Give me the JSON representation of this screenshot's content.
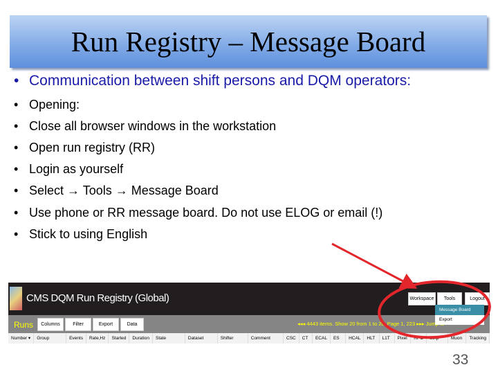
{
  "slide": {
    "title": "Run Registry – Message Board",
    "page_number": "33",
    "bullets": [
      "Communication between shift persons and DQM operators:",
      "Opening:",
      "Close all browser windows in the workstation",
      "Open run registry (RR)",
      "Login as yourself",
      "Select → Tools → Message Board",
      "Use phone or RR message board. Do not use ELOG or email (!)",
      "Stick to using English"
    ],
    "bullet_char": "•",
    "accent": "#e3262b"
  },
  "screenshot": {
    "app_title": "CMS DQM Run Registry (Global)",
    "section": "Runs",
    "toolbar_buttons": [
      "Columns",
      "Filter",
      "Export",
      "Data"
    ],
    "top_buttons": [
      "Workspace",
      "Tools",
      "Logout"
    ],
    "menu_items": [
      "Message Board",
      "Export"
    ],
    "pagination": "4443 items. Show 20 from 1 to 20. Page 1, 223",
    "jump_to": "Jump to",
    "columns": [
      "Number ▾",
      "Group",
      "Events",
      "Rate,Hz",
      "Started",
      "Duration",
      "State",
      "Dataset",
      "Shifter",
      "Comment",
      "CSC",
      "CT",
      "ECAL",
      "ES",
      "HCAL",
      "HLT",
      "L1T",
      "Pixel",
      "RPC",
      "Strip",
      "Muon",
      "Tracking"
    ]
  }
}
